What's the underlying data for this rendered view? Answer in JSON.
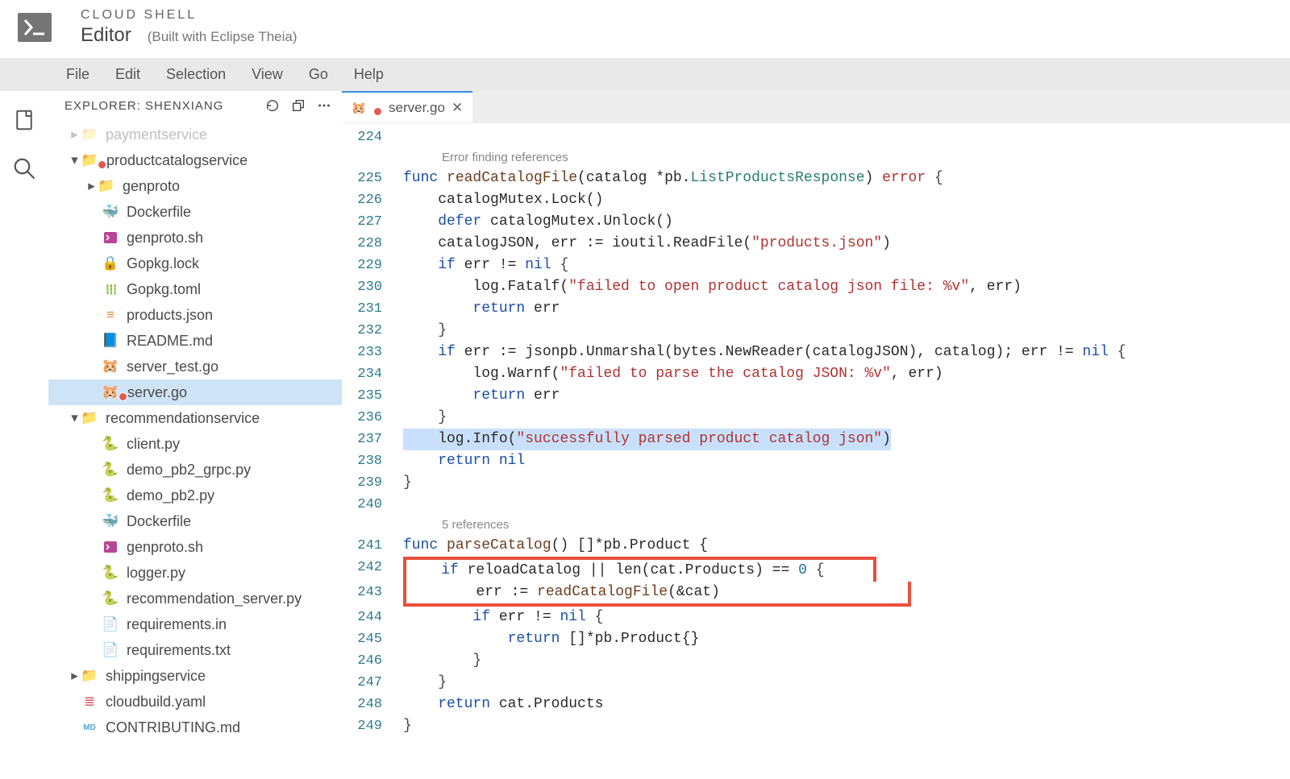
{
  "header": {
    "suptitle": "CLOUD SHELL",
    "title": "Editor",
    "subtitle": "(Built with Eclipse Theia)"
  },
  "menubar": {
    "items": [
      "File",
      "Edit",
      "Selection",
      "View",
      "Go",
      "Help"
    ]
  },
  "sidebar": {
    "title": "EXPLORER: SHENXIANG",
    "tree": [
      {
        "l": "paymentservice",
        "d": 1,
        "kind": "folder-collapsed-faded"
      },
      {
        "l": "productcatalogservice",
        "d": 1,
        "kind": "folder-open-err"
      },
      {
        "l": "genproto",
        "d": 2,
        "kind": "folder-collapsed"
      },
      {
        "l": "Dockerfile",
        "d": 2,
        "kind": "docker"
      },
      {
        "l": "genproto.sh",
        "d": 2,
        "kind": "term"
      },
      {
        "l": "Gopkg.lock",
        "d": 2,
        "kind": "lock"
      },
      {
        "l": "Gopkg.toml",
        "d": 2,
        "kind": "toml"
      },
      {
        "l": "products.json",
        "d": 2,
        "kind": "json"
      },
      {
        "l": "README.md",
        "d": 2,
        "kind": "md"
      },
      {
        "l": "server_test.go",
        "d": 2,
        "kind": "go"
      },
      {
        "l": "server.go",
        "d": 2,
        "kind": "go-err",
        "selected": true
      },
      {
        "l": "recommendationservice",
        "d": 1,
        "kind": "folder-open"
      },
      {
        "l": "client.py",
        "d": 2,
        "kind": "py"
      },
      {
        "l": "demo_pb2_grpc.py",
        "d": 2,
        "kind": "py"
      },
      {
        "l": "demo_pb2.py",
        "d": 2,
        "kind": "py"
      },
      {
        "l": "Dockerfile",
        "d": 2,
        "kind": "docker"
      },
      {
        "l": "genproto.sh",
        "d": 2,
        "kind": "term"
      },
      {
        "l": "logger.py",
        "d": 2,
        "kind": "py"
      },
      {
        "l": "recommendation_server.py",
        "d": 2,
        "kind": "py"
      },
      {
        "l": "requirements.in",
        "d": 2,
        "kind": "txt"
      },
      {
        "l": "requirements.txt",
        "d": 2,
        "kind": "txt"
      },
      {
        "l": "shippingservice",
        "d": 1,
        "kind": "folder-collapsed"
      },
      {
        "l": "cloudbuild.yaml",
        "d": 1,
        "kind": "yaml"
      },
      {
        "l": "CONTRIBUTING.md",
        "d": 1,
        "kind": "contrib"
      }
    ]
  },
  "tab": {
    "label": "server.go"
  },
  "codelens": {
    "a": "Error finding references",
    "b": "5 references"
  },
  "lines": {
    "n224": "224",
    "n225": "225",
    "n226": "226",
    "n227": "227",
    "n228": "228",
    "n229": "229",
    "n230": "230",
    "n231": "231",
    "n232": "232",
    "n233": "233",
    "n234": "234",
    "n235": "235",
    "n236": "236",
    "n237": "237",
    "n238": "238",
    "n239": "239",
    "n240": "240",
    "n241": "241",
    "n242": "242",
    "n243": "243",
    "n244": "244",
    "n245": "245",
    "n246": "246",
    "n247": "247",
    "n248": "248",
    "n249": "249"
  },
  "code": {
    "l225_func": "func ",
    "l225_name": "readCatalogFile",
    "l225_sig1": "(catalog *pb.",
    "l225_type": "ListProductsResponse",
    "l225_sig2": ") ",
    "l225_err": "error",
    "l225_brace": " {",
    "l226": "    catalogMutex.Lock()",
    "l227_defer": "    defer",
    "l227_rest": " catalogMutex.Unlock()",
    "l228_a": "    catalogJSON, err := ioutil.ReadFile(",
    "l228_s": "\"products.json\"",
    "l228_b": ")",
    "l229_if": "    if",
    "l229_cond": " err != ",
    "l229_nil": "nil",
    "l229_brace": " {",
    "l230_a": "        log.Fatalf(",
    "l230_s": "\"failed to open product catalog json file: %v\"",
    "l230_b": ", err)",
    "l231_ret": "        return",
    "l231_v": " err",
    "l232": "    }",
    "l233_if": "    if",
    "l233_a": " err := jsonpb.Unmarshal(bytes.NewReader(catalogJSON), catalog); err != ",
    "l233_nil": "nil",
    "l233_brace": " {",
    "l234_a": "        log.Warnf(",
    "l234_s": "\"failed to parse the catalog JSON: %v\"",
    "l234_b": ", err)",
    "l235_ret": "        return",
    "l235_v": " err",
    "l236": "    }",
    "l237_a": "    log.Info(",
    "l237_s": "\"successfully parsed product catalog json\"",
    "l237_b": ")",
    "l238_ret": "    return",
    "l238_nil": " nil",
    "l239": "}",
    "l241_func": "func ",
    "l241_name": "parseCatalog",
    "l241_rest": "() []*pb.Product {",
    "l242_if": "    if",
    "l242_rest": " reloadCatalog || len(cat.Products) == ",
    "l242_zero": "0",
    "l242_brace": " {",
    "l243_a": "        err := ",
    "l243_fn": "readCatalogFile",
    "l243_b": "(&cat)",
    "l244_if": "        if",
    "l244_cond": " err != ",
    "l244_nil": "nil",
    "l244_brace": " {",
    "l245_ret": "            return",
    "l245_rest": " []*pb.Product{}",
    "l246": "        }",
    "l247": "    }",
    "l248_ret": "    return",
    "l248_rest": " cat.Products",
    "l249": "}"
  }
}
